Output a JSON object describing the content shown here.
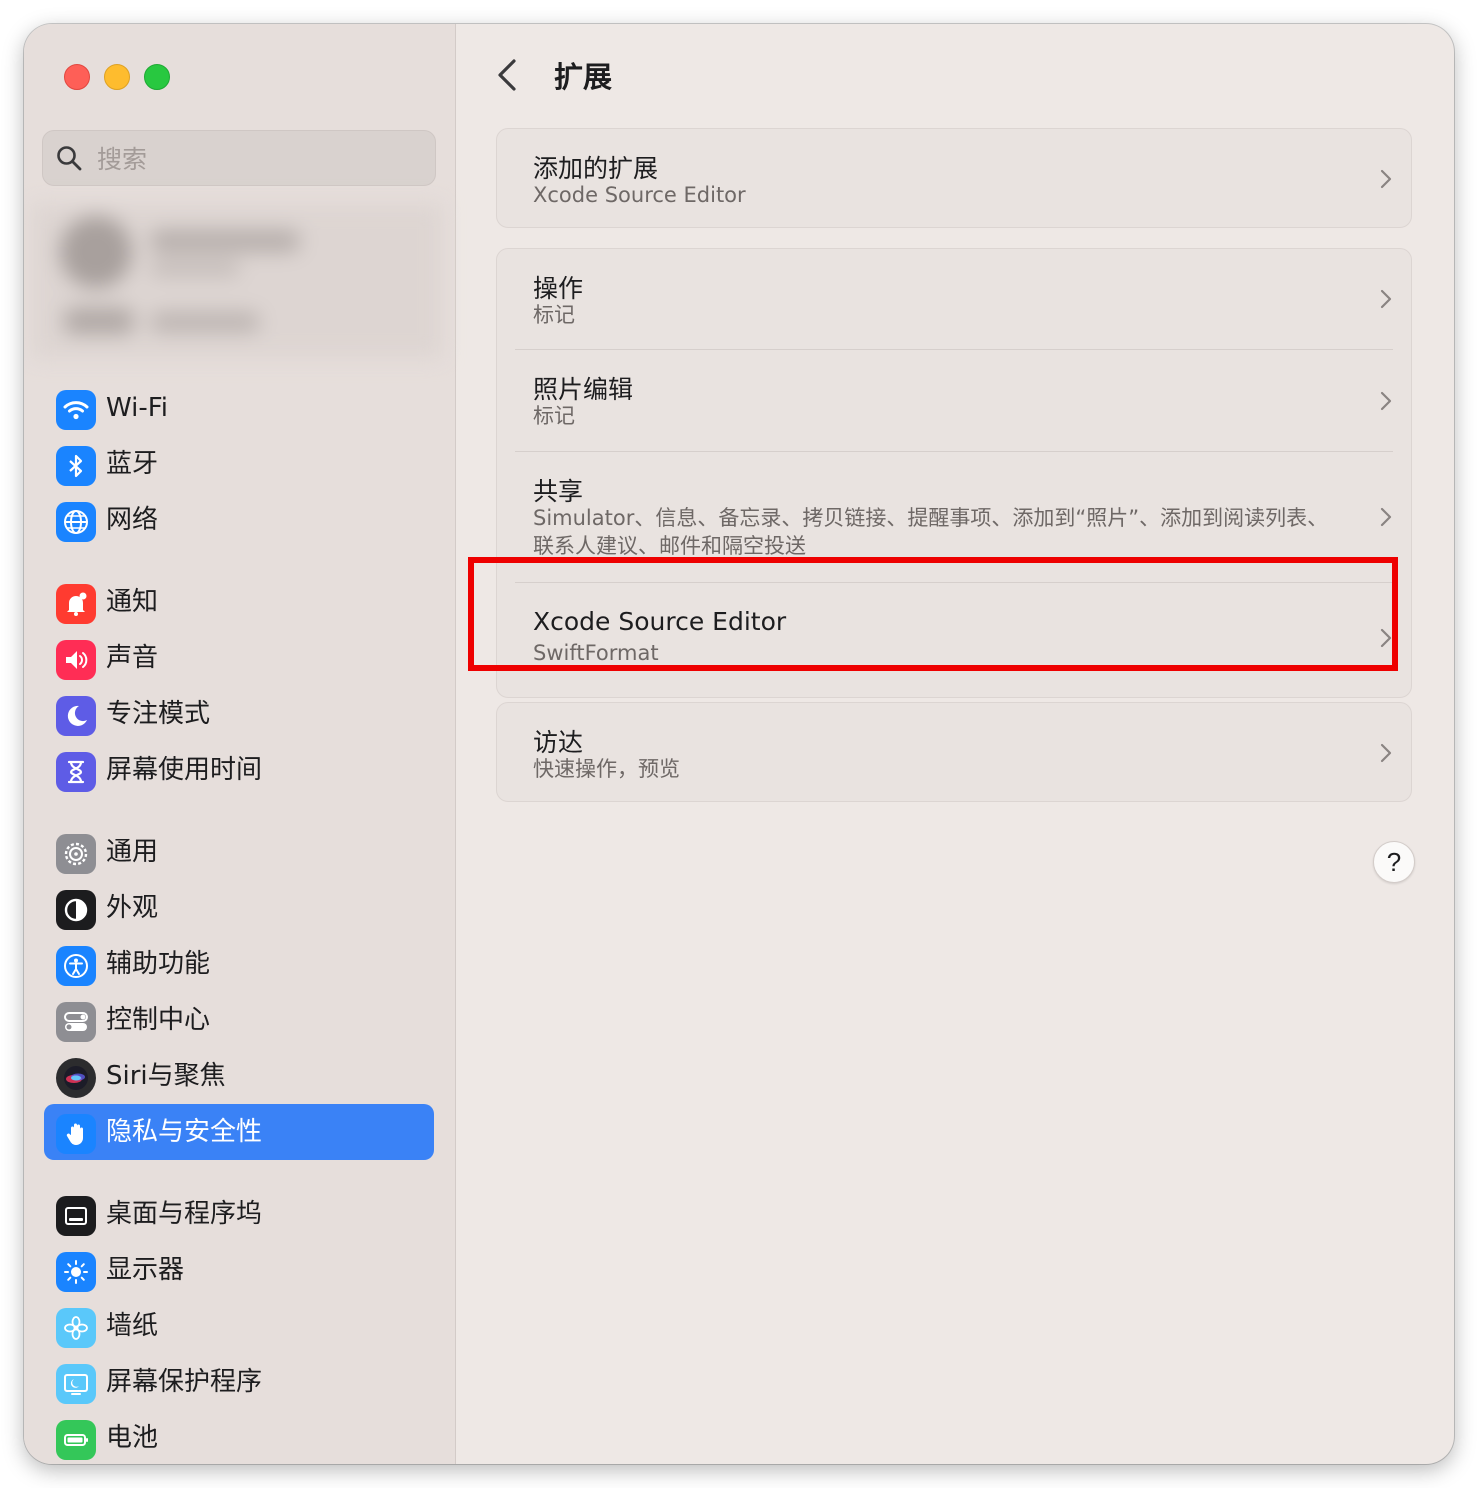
{
  "window": {
    "traffic_lights": [
      "close",
      "minimize",
      "zoom"
    ]
  },
  "sidebar": {
    "search": {
      "placeholder": "搜索",
      "value": ""
    },
    "items": [
      {
        "label": "Wi-Fi",
        "icon": "wifi-icon",
        "color": "#1a84ff"
      },
      {
        "label": "蓝牙",
        "icon": "bluetooth-icon",
        "color": "#1a84ff"
      },
      {
        "label": "网络",
        "icon": "globe-icon",
        "color": "#1a84ff"
      },
      {
        "label": "通知",
        "icon": "bell-icon",
        "color": "#ff3b30"
      },
      {
        "label": "声音",
        "icon": "speaker-icon",
        "color": "#ff2d55"
      },
      {
        "label": "专注模式",
        "icon": "moon-icon",
        "color": "#5e5ce6"
      },
      {
        "label": "屏幕使用时间",
        "icon": "hourglass-icon",
        "color": "#5e5ce6"
      },
      {
        "label": "通用",
        "icon": "gear-icon",
        "color": "#8e8e93"
      },
      {
        "label": "外观",
        "icon": "appearance-icon",
        "color": "#1c1c1e"
      },
      {
        "label": "辅助功能",
        "icon": "accessibility-icon",
        "color": "#1a84ff"
      },
      {
        "label": "控制中心",
        "icon": "control-center-icon",
        "color": "#8e8e93"
      },
      {
        "label": "Siri与聚焦",
        "icon": "siri-icon",
        "color": "#2c2c2e"
      },
      {
        "label": "隐私与安全性",
        "icon": "hand-icon",
        "color": "#1a84ff",
        "selected": true
      },
      {
        "label": "桌面与程序坞",
        "icon": "dock-icon",
        "color": "#1c1c1e"
      },
      {
        "label": "显示器",
        "icon": "sun-icon",
        "color": "#1a84ff"
      },
      {
        "label": "墙纸",
        "icon": "flower-icon",
        "color": "#5ac8fa"
      },
      {
        "label": "屏幕保护程序",
        "icon": "screensaver-icon",
        "color": "#5ac8fa"
      },
      {
        "label": "电池",
        "icon": "battery-icon",
        "color": "#34c759"
      }
    ]
  },
  "content": {
    "title": "扩展",
    "groups": [
      {
        "rows": [
          {
            "title": "添加的扩展",
            "subtitle": "Xcode Source Editor"
          }
        ]
      },
      {
        "rows": [
          {
            "title": "操作",
            "subtitle": "标记"
          },
          {
            "title": "照片编辑",
            "subtitle": "标记"
          },
          {
            "title": "共享",
            "subtitle": "Simulator、信息、备忘录、拷贝链接、提醒事项、添加到“照片”、添加到阅读列表、联系人建议、邮件和隔空投送"
          },
          {
            "title": "Xcode Source Editor",
            "subtitle": "SwiftFormat",
            "highlighted": true
          }
        ]
      },
      {
        "rows": [
          {
            "title": "访达",
            "subtitle": "快速操作，预览"
          }
        ]
      }
    ],
    "help_label": "?",
    "highlight_color": "#ee0000"
  }
}
